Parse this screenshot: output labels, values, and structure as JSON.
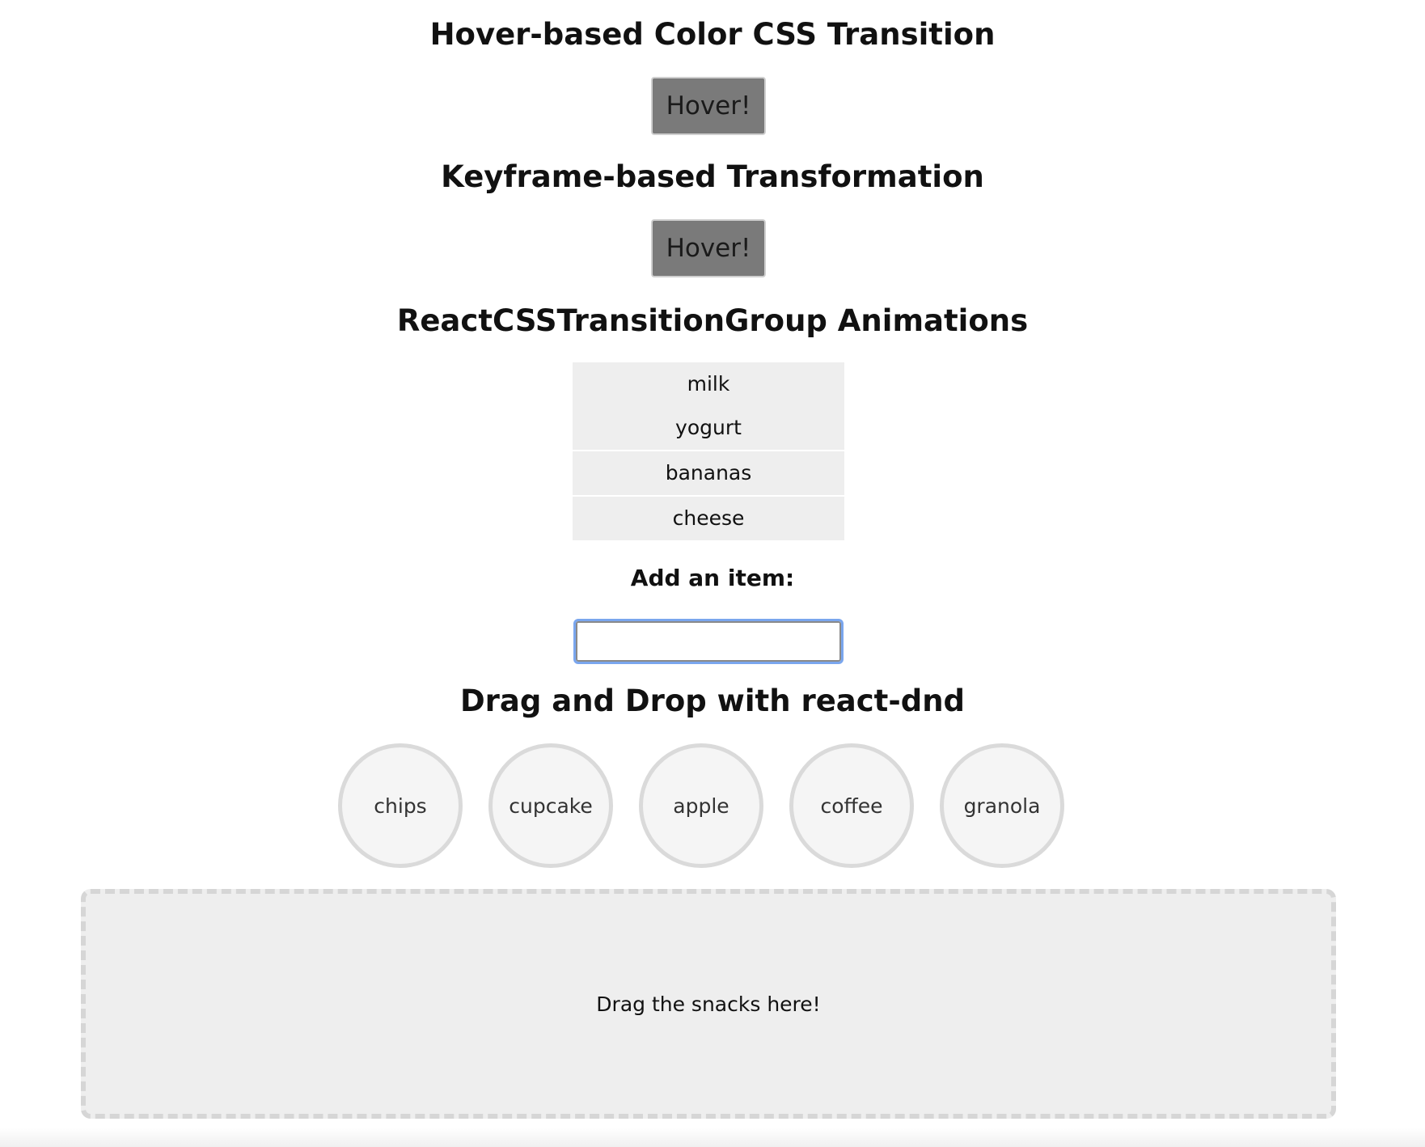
{
  "sections": {
    "hover_transition": {
      "title": "Hover-based Color CSS Transition",
      "button_label": "Hover!"
    },
    "keyframe": {
      "title": "Keyframe-based Transformation",
      "button_label": "Hover!"
    },
    "transition_group": {
      "title": "ReactCSSTransitionGroup Animations",
      "items": [
        "milk",
        "yogurt",
        "bananas",
        "cheese"
      ],
      "add_label": "Add an item:",
      "input_value": "",
      "input_placeholder": ""
    },
    "drag_drop": {
      "title": "Drag and Drop with react-dnd",
      "snacks": [
        "chips",
        "cupcake",
        "apple",
        "coffee",
        "granola"
      ],
      "dropzone_text": "Drag the snacks here!"
    }
  },
  "colors": {
    "button_bg": "#7a7a7a",
    "list_bg": "#eeeeee",
    "input_focus": "#7aa6ee",
    "snack_bg": "#f5f5f5",
    "snack_border": "#dadada",
    "dropzone_bg": "#eeeeee",
    "dropzone_border": "#d6d6d6"
  }
}
